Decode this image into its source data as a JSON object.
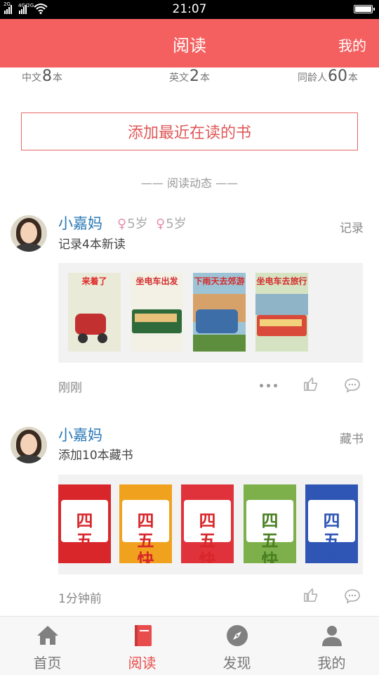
{
  "status_bar": {
    "time": "21:07",
    "signal1": "2G",
    "signal2": "4G/2G"
  },
  "app_bar": {
    "title": "阅读",
    "right_action": "我的"
  },
  "stats": [
    {
      "label": "中文",
      "count": "8",
      "unit": "本"
    },
    {
      "label": "英文",
      "count": "2",
      "unit": "本"
    },
    {
      "label": "同龄人",
      "count": "60",
      "unit": "本"
    }
  ],
  "add_book_button": "添加最近在读的书",
  "feed_heading": "—— 阅读动态 ——",
  "feed": [
    {
      "user": "小嘉妈",
      "kids": [
        {
          "gender_symbol": "♀",
          "age": "5岁"
        },
        {
          "gender_symbol": "♀",
          "age": "5岁"
        }
      ],
      "action": "记录4本新读",
      "tag": "记录",
      "time": "刚刚",
      "books": [
        "来着了",
        "坐电车出发",
        "下雨天去郊游",
        "坐电车去旅行"
      ]
    },
    {
      "user": "小嘉妈",
      "kids": [],
      "action": "添加10本藏书",
      "tag": "藏书",
      "time": "1分钟前",
      "books": [
        "四五快读",
        "四五快读",
        "四五快读",
        "四五快读",
        "四五快读"
      ]
    }
  ],
  "tabs": [
    {
      "label": "首页",
      "icon": "home-icon",
      "active": false
    },
    {
      "label": "阅读",
      "icon": "book-icon",
      "active": true
    },
    {
      "label": "发现",
      "icon": "compass-icon",
      "active": false
    },
    {
      "label": "我的",
      "icon": "person-icon",
      "active": false
    }
  ],
  "colors": {
    "accent": "#f46060",
    "link": "#2a78b6",
    "active_tab": "#e94c4c"
  }
}
